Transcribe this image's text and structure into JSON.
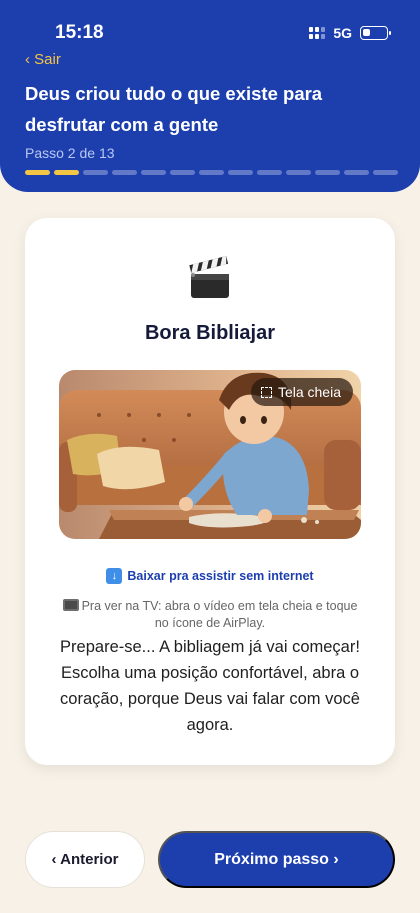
{
  "status_bar": {
    "time": "15:18",
    "network": "5G",
    "battery_level": 0.35
  },
  "header": {
    "back_label": "‹ Sair",
    "title": "Deus criou tudo o que existe para desfrutar com a gente",
    "step_label": "Passo 2 de 13",
    "progress": {
      "current": 2,
      "total": 13
    },
    "colors": {
      "background": "#1d3fae",
      "accent": "#f3c544"
    }
  },
  "card": {
    "icon": "clapperboard-icon",
    "title": "Bora Bibliajar",
    "video": {
      "fullscreen_label": "Tela cheia"
    },
    "download_label": "Baixar pra assistir sem internet",
    "tv_tip": "Pra ver na TV: abra o vídeo em tela cheia e toque no ícone de AirPlay.",
    "intro_text": "Prepare-se... A bibliagem já vai começar! Escolha uma posição confortável, abra o coração, porque Deus vai falar com você agora."
  },
  "footer": {
    "prev_label": "‹ Anterior",
    "next_label": "Próximo passo ›"
  }
}
